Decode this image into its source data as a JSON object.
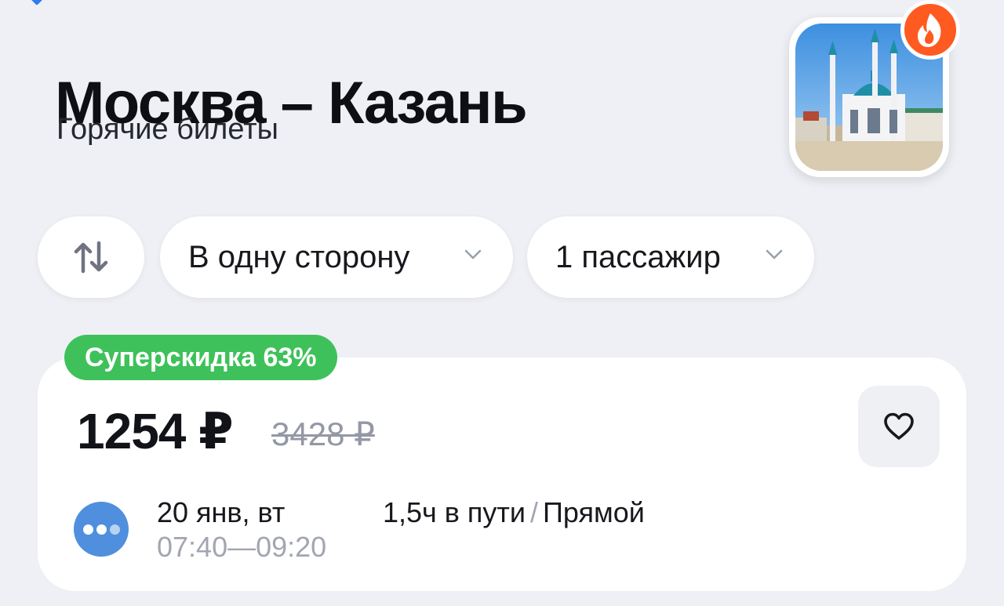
{
  "header": {
    "title": "Москва – Казань",
    "subtitle": "Горячие билеты",
    "thumbnail_icon": "kazan-mosque-photo",
    "hot_icon": "fire-icon"
  },
  "filters": {
    "swap_icon": "swap-arrows-icon",
    "direction_label": "В одну сторону",
    "passengers_label": "1 пассажир",
    "chevron_icon": "chevron-down-icon"
  },
  "ticket": {
    "discount_badge": "Суперскидка 63%",
    "price": "1254 ₽",
    "old_price": "3428 ₽",
    "favorite_icon": "heart-icon",
    "carrier_icon": "carrier-logo-icon",
    "date": "20 янв, вт",
    "departure": "07:40",
    "arrival": "09:20",
    "time_separator": "—",
    "duration": "1,5ч в пути",
    "duration_separator": "/",
    "stops": "Прямой"
  },
  "colors": {
    "background": "#eef0f5",
    "discount_green": "#3ec15a",
    "hot_orange": "#ff5a1f",
    "carrier_blue": "#4f8fdd",
    "muted_text": "#a2a6b1"
  }
}
